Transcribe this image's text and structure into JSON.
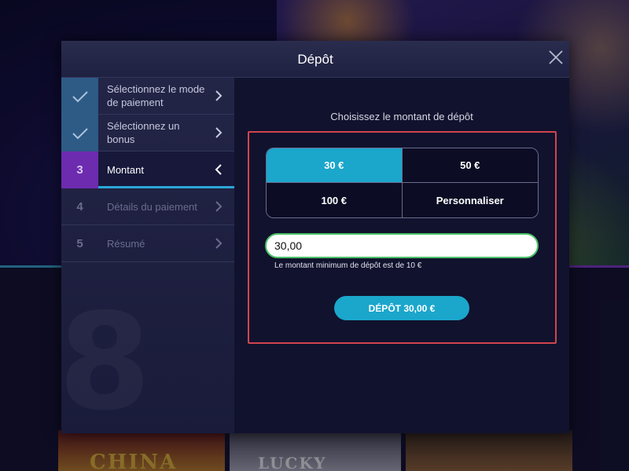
{
  "background": {
    "games": [
      "CHINA",
      "LUCKY RICHES",
      ""
    ]
  },
  "modal": {
    "title": "Dépôt",
    "close_icon": "close-icon",
    "watermark": "8"
  },
  "steps": [
    {
      "badge": "✓",
      "label": "Sélectionnez le mode de paiement",
      "state": "done",
      "icon": "checkmark-icon"
    },
    {
      "badge": "✓",
      "label": "Sélectionnez un bonus",
      "state": "done",
      "icon": "checkmark-icon"
    },
    {
      "badge": "3",
      "label": "Montant",
      "state": "active"
    },
    {
      "badge": "4",
      "label": "Détails du paiement",
      "state": "pending"
    },
    {
      "badge": "5",
      "label": "Résumé",
      "state": "pending"
    }
  ],
  "main": {
    "prompt": "Choisissez le montant de dépôt",
    "amount_options": [
      "30 €",
      "50 €",
      "100 €",
      "Personnaliser"
    ],
    "selected_option": "30 €",
    "amount_value": "30,00",
    "hint": "Le montant minimum de dépôt est de 10 €",
    "deposit_button": "DÉPÔT 30,00 €"
  },
  "colors": {
    "accent": "#1ba6cc",
    "step_done": "#2e5a86",
    "step_active": "#6d2bb0",
    "highlight_frame": "#d0454f",
    "input_border": "#49c066"
  }
}
